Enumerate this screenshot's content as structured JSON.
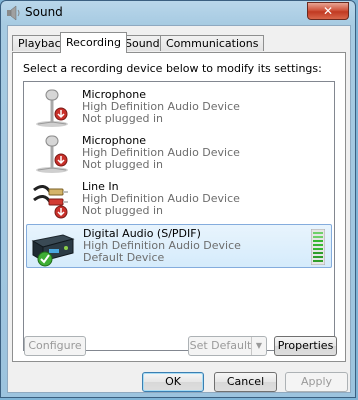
{
  "window": {
    "title": "Sound",
    "close_glyph": "✕"
  },
  "tabs": [
    {
      "label": "Playback",
      "active": false
    },
    {
      "label": "Recording",
      "active": true
    },
    {
      "label": "Sounds",
      "active": false
    },
    {
      "label": "Communications",
      "active": false
    }
  ],
  "instruction": "Select a recording device below to modify its settings:",
  "devices": [
    {
      "name": "Microphone",
      "driver": "High Definition Audio Device",
      "status": "Not plugged in",
      "icon": "microphone-icon",
      "selected": false
    },
    {
      "name": "Microphone",
      "driver": "High Definition Audio Device",
      "status": "Not plugged in",
      "icon": "microphone-icon",
      "selected": false
    },
    {
      "name": "Line In",
      "driver": "High Definition Audio Device",
      "status": "Not plugged in",
      "icon": "line-in-cable-icon",
      "selected": false
    },
    {
      "name": "Digital Audio (S/PDIF)",
      "driver": "High Definition Audio Device",
      "status": "Default Device",
      "icon": "digital-audio-device-icon",
      "selected": true
    }
  ],
  "buttons": {
    "configure": "Configure",
    "set_default": "Set Default",
    "properties": "Properties",
    "ok": "OK",
    "cancel": "Cancel",
    "apply": "Apply"
  },
  "colors": {
    "selection": "#d5ebfb",
    "meter_green": "#37b531",
    "close_red": "#c13a22"
  }
}
